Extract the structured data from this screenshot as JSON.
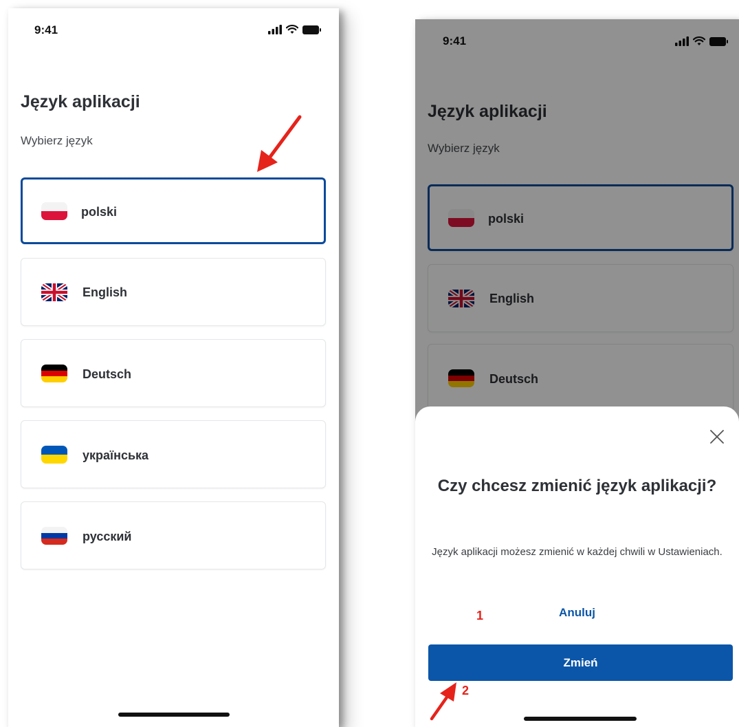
{
  "status_bar": {
    "time": "9:41"
  },
  "language_screen": {
    "title": "Język aplikacji",
    "subtitle": "Wybierz język",
    "languages": [
      {
        "label": "polski",
        "flag": "flag-poland-icon",
        "selected": true
      },
      {
        "label": "English",
        "flag": "flag-uk-icon",
        "selected": false
      },
      {
        "label": "Deutsch",
        "flag": "flag-germany-icon",
        "selected": false
      },
      {
        "label": "українська",
        "flag": "flag-ukraine-icon",
        "selected": false
      },
      {
        "label": "русский",
        "flag": "flag-russia-icon",
        "selected": false
      }
    ]
  },
  "confirm_dialog": {
    "title": "Czy chcesz zmienić język aplikacji?",
    "message": "Język aplikacji możesz zmienić w każdej chwili w Ustawieniach.",
    "cancel_label": "Anuluj",
    "confirm_label": "Zmień"
  },
  "annotations": {
    "step_1": "1",
    "step_2": "2"
  },
  "colors": {
    "accent_blue": "#0b56a8",
    "selected_border": "#0b4a9a",
    "annotation_red": "#e5231b",
    "dim_overlay": "rgba(0,0,0,0.43)"
  }
}
